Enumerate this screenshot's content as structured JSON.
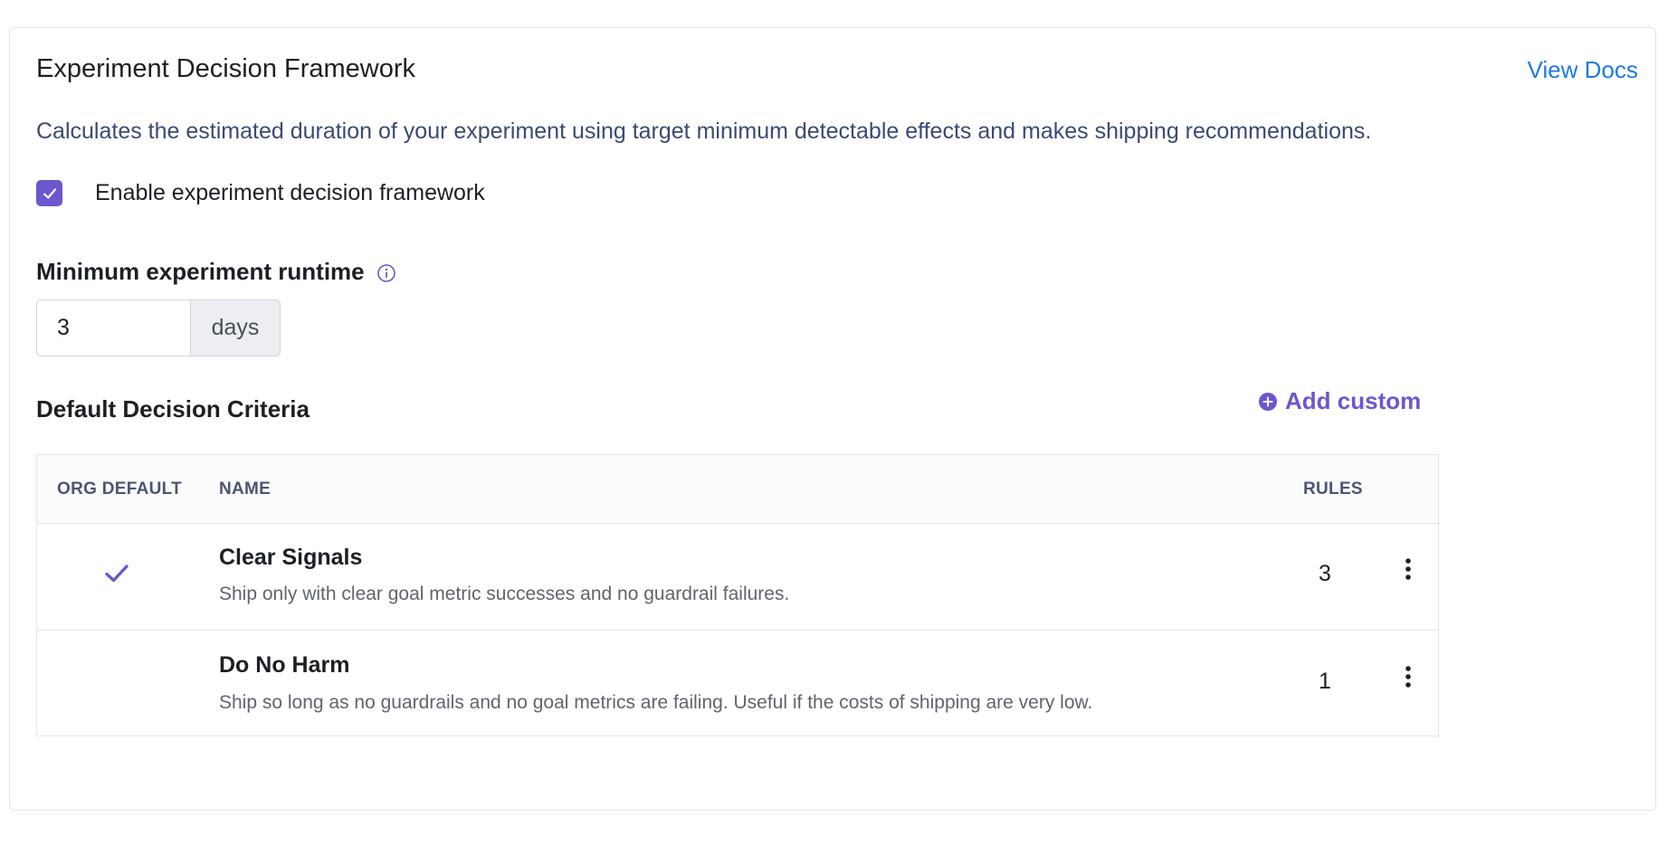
{
  "header": {
    "title": "Experiment Decision Framework",
    "docs_link": "View Docs"
  },
  "description": "Calculates the estimated duration of your experiment using target minimum detectable effects and makes shipping recommendations.",
  "enable_checkbox": {
    "label": "Enable experiment decision framework",
    "checked": true
  },
  "runtime": {
    "label": "Minimum experiment runtime",
    "value": "3",
    "unit": "days"
  },
  "criteria": {
    "title": "Default Decision Criteria",
    "add_label": "Add custom",
    "columns": {
      "org_default": "ORG DEFAULT",
      "name": "NAME",
      "rules": "RULES"
    },
    "rows": [
      {
        "org_default": true,
        "name": "Clear Signals",
        "description": "Ship only with clear goal metric successes and no guardrail failures.",
        "rules": "3"
      },
      {
        "org_default": false,
        "name": "Do No Harm",
        "description": "Ship so long as no guardrails and no goal metrics are failing. Useful if the costs of shipping are very low.",
        "rules": "1"
      }
    ]
  },
  "colors": {
    "accent": "#6e56cf",
    "link": "#1f7ae0",
    "description_text": "#3b4a72"
  }
}
